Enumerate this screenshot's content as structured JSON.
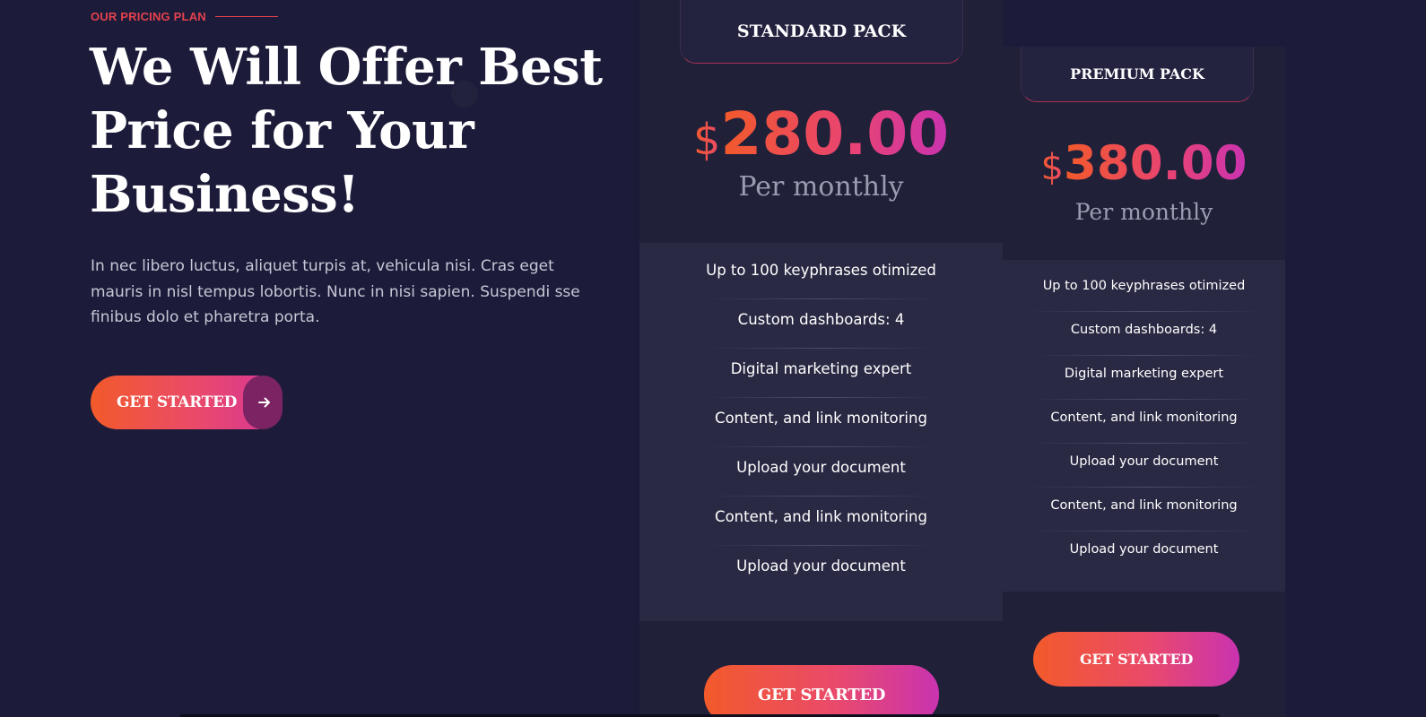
{
  "hero": {
    "eyebrow": "OUR PRICING PLAN",
    "headline": "We Will Offer Best Price for Your Business!",
    "description": "In nec libero luctus, aliquet turpis at, vehicula nisi. Cras eget mauris in nisl tempus lobortis. Nunc in nisi sapien. Suspendi sse finibus dolo et pharetra porta.",
    "cta_label": "GET STARTED",
    "cta_icon": "arrow-right-icon"
  },
  "plans": [
    {
      "name": "STANDARD PACK",
      "currency": "$",
      "price": "280.00",
      "period": "Per monthly",
      "features": [
        "Up to 100 keyphrases otimized",
        "Custom dashboards: 4",
        "Digital marketing expert",
        "Content, and link monitoring",
        "Upload your document",
        "Content, and link monitoring",
        "Upload your document"
      ],
      "cta_label": "GET STARTED"
    },
    {
      "name": "PREMIUM PACK",
      "currency": "$",
      "price": "380.00",
      "period": "Per monthly",
      "features": [
        "Up to 100 keyphrases otimized",
        "Custom dashboards: 4",
        "Digital marketing expert",
        "Content, and link monitoring",
        "Upload your document",
        "Content, and link monitoring",
        "Upload your document"
      ],
      "cta_label": "GET STARTED"
    }
  ],
  "colors": {
    "background": "#1c1c3a",
    "accent_start": "#f25a2a",
    "accent_end": "#c933b0",
    "eyebrow": "#e5414d"
  }
}
